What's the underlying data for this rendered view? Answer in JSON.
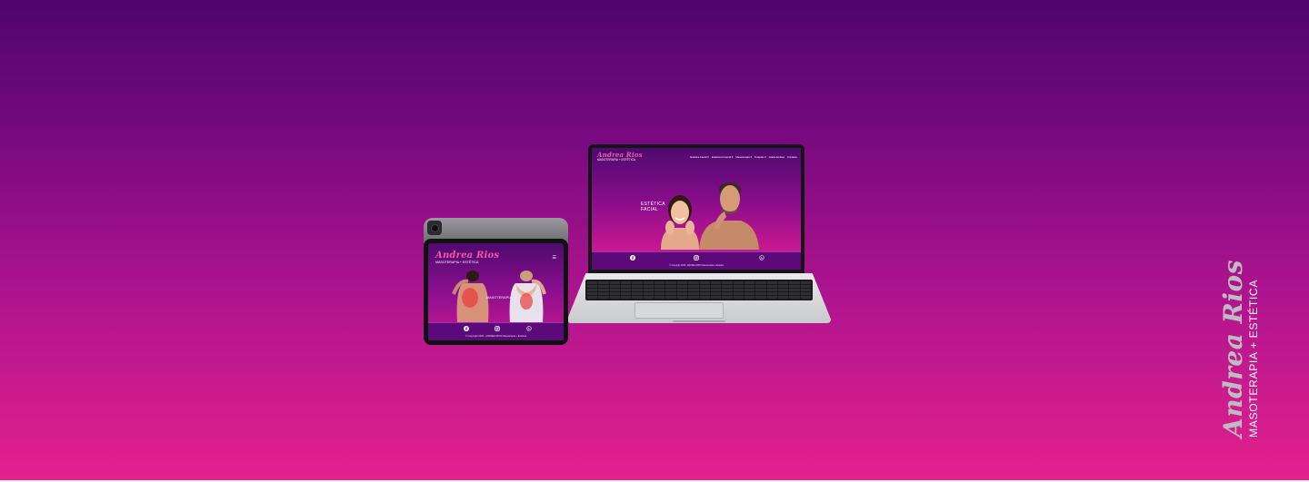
{
  "brand": {
    "name": "Andrea Rios",
    "tagline": "MASOTERAPIA + ESTÉTICA"
  },
  "laptop_site": {
    "logo_name": "Andrea Rios",
    "logo_tagline": "MASOTERAPIA + ESTÉTICA",
    "nav": [
      {
        "label": "Estética Facial ▾"
      },
      {
        "label": "Estética Corporal ▾"
      },
      {
        "label": "Masoterapia ▾"
      },
      {
        "label": "Terapias ▾"
      },
      {
        "label": "Gratis Andrea"
      },
      {
        "label": "Contacto"
      }
    ],
    "hero_line1": "ESTÉTICA",
    "hero_line2": "FACIAL",
    "social_icons": [
      "facebook-icon",
      "instagram-icon",
      "whatsapp-icon"
    ],
    "copyright": "© Copyright 2025 - ANDREA RIOS Masoterapia + Estética"
  },
  "tablet_site": {
    "logo_name": "Andrea Rios",
    "logo_tagline": "MASOTERAPIA + ESTÉTICA",
    "menu_icon": "☰",
    "hero_title": "MASOTERAPIA",
    "social_icons": [
      "facebook-icon",
      "instagram-icon",
      "whatsapp-icon"
    ],
    "copyright": "© Copyright 2025 - ANDREA RIOS Masoterapia + Estética"
  },
  "colors": {
    "accent_pink": "#e5218d",
    "deep_purple": "#4e056d",
    "logo_pink": "#f05aa9"
  }
}
